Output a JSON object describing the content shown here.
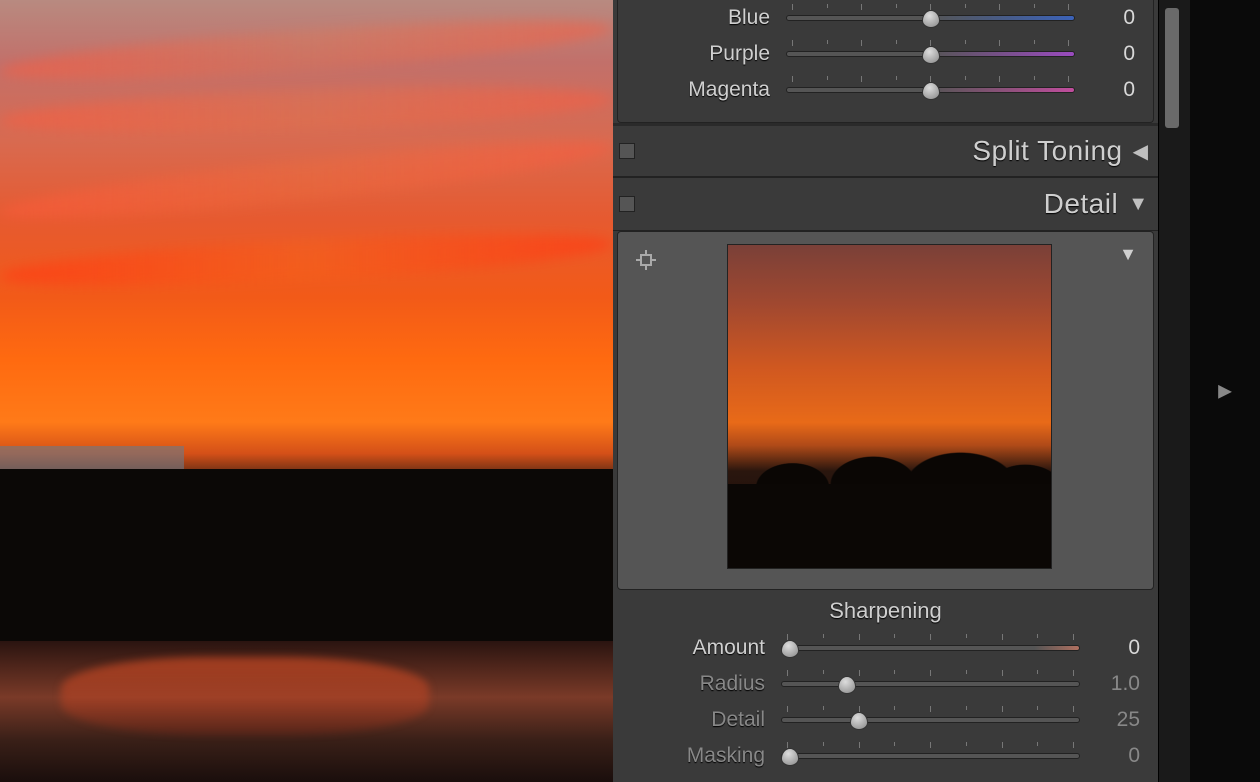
{
  "color_sliders": [
    {
      "label": "Blue",
      "value": "0",
      "pos": 50,
      "gradient": "gradient-blue"
    },
    {
      "label": "Purple",
      "value": "0",
      "pos": 50,
      "gradient": "gradient-purple"
    },
    {
      "label": "Magenta",
      "value": "0",
      "pos": 50,
      "gradient": "gradient-magenta"
    }
  ],
  "sections": {
    "split_toning": {
      "title": "Split Toning",
      "expanded": false
    },
    "detail": {
      "title": "Detail",
      "expanded": true
    }
  },
  "sharpening": {
    "heading": "Sharpening",
    "sliders": [
      {
        "label": "Amount",
        "value": "0",
        "pos": 3,
        "gradient": "gradient-amount",
        "dim": false
      },
      {
        "label": "Radius",
        "value": "1.0",
        "pos": 22,
        "gradient": "",
        "dim": true
      },
      {
        "label": "Detail",
        "value": "25",
        "pos": 26,
        "gradient": "",
        "dim": true
      },
      {
        "label": "Masking",
        "value": "0",
        "pos": 3,
        "gradient": "",
        "dim": true
      }
    ]
  }
}
